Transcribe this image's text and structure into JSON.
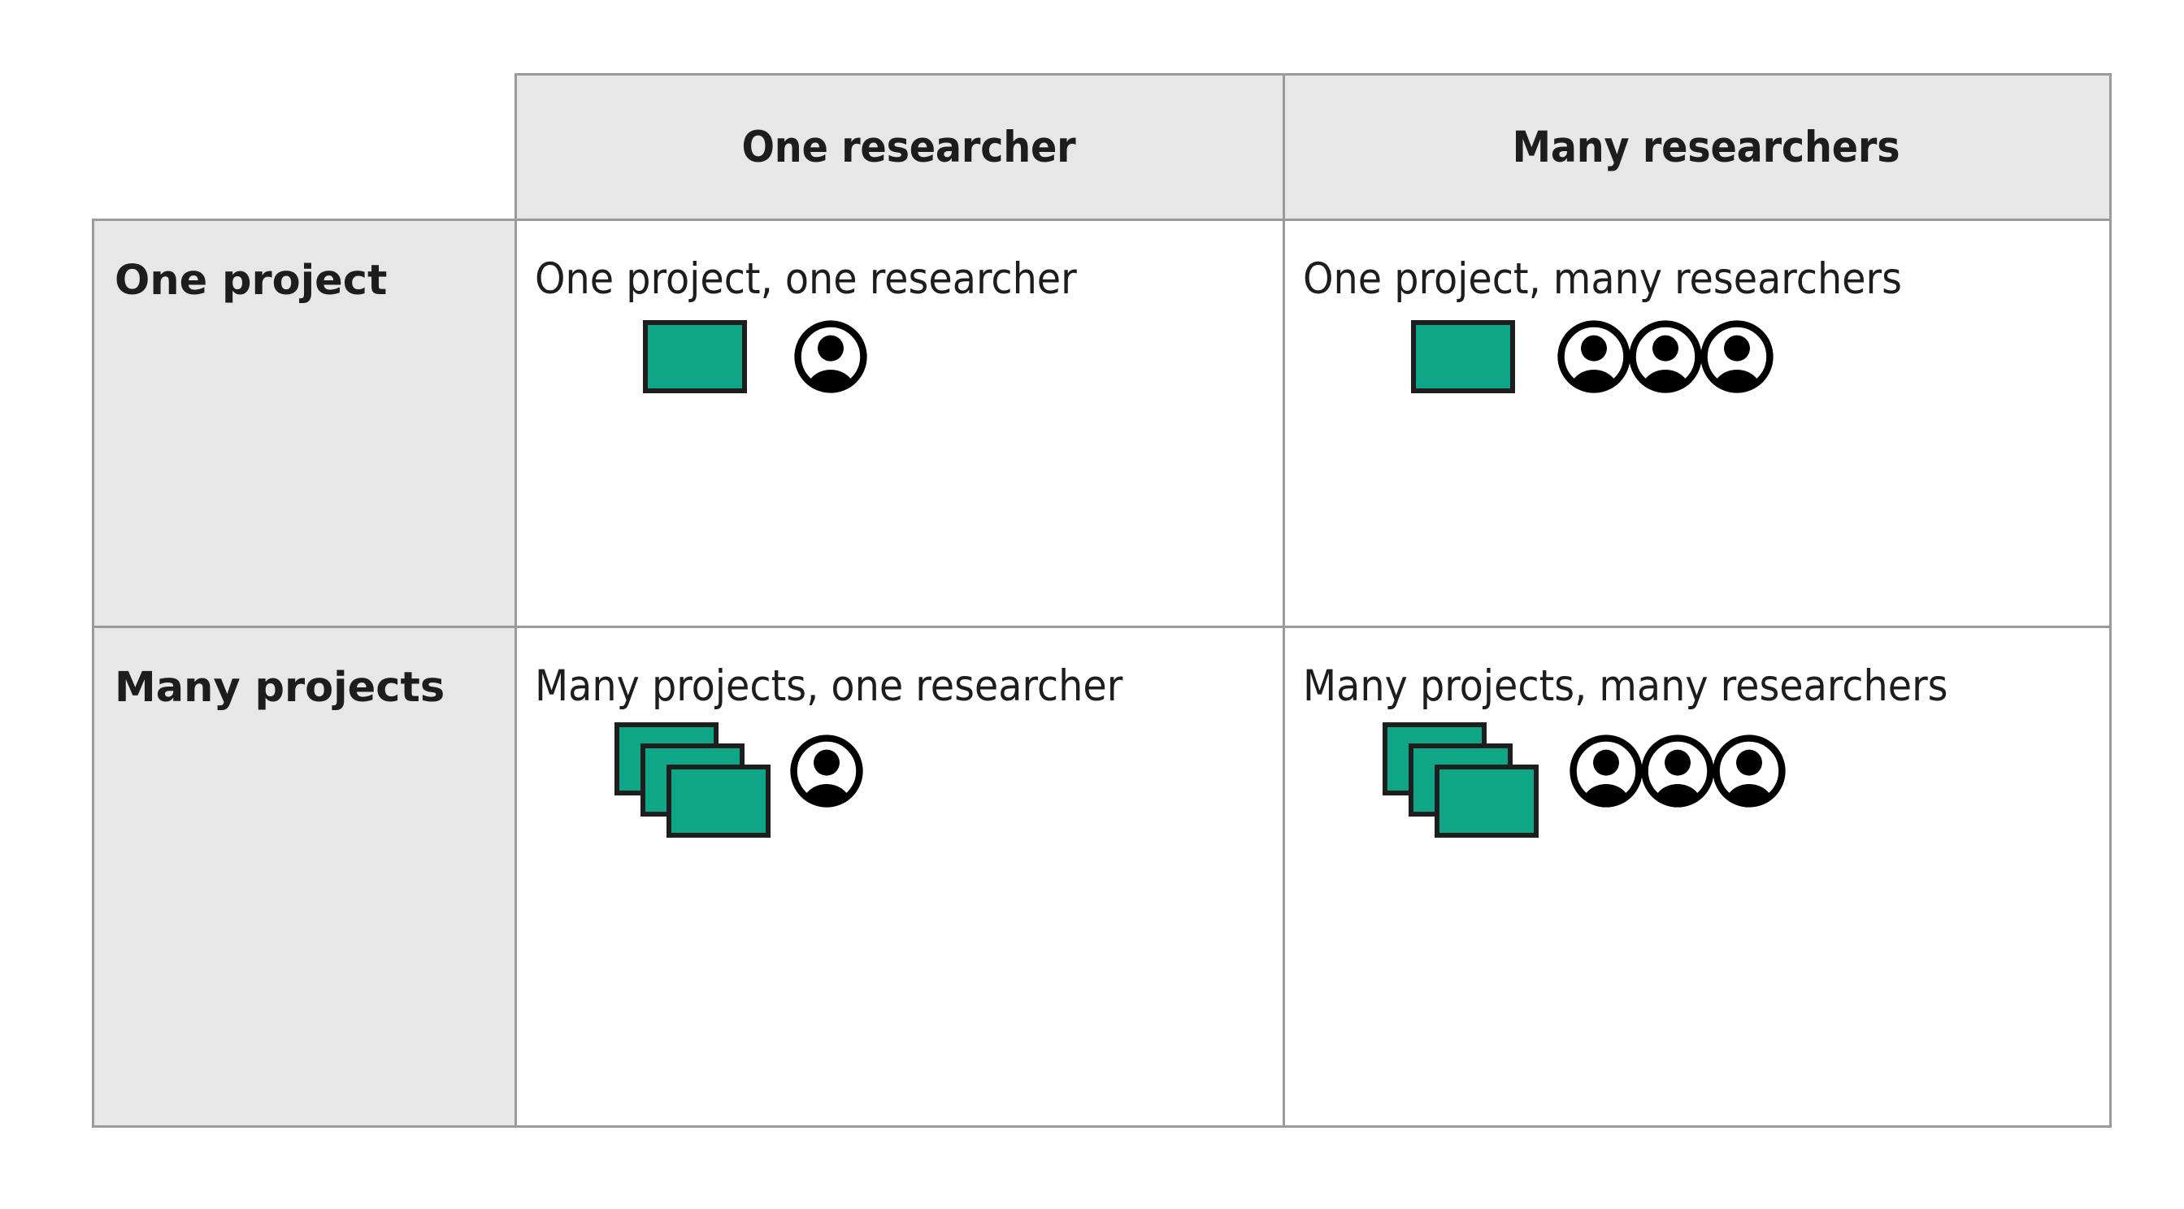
{
  "table": {
    "corner_label": "",
    "column_headers": [
      {
        "id": "one-researcher",
        "label": "One researcher"
      },
      {
        "id": "many-researchers",
        "label": "Many researchers"
      }
    ],
    "rows": [
      {
        "id": "one-project",
        "header": "One project",
        "cells": [
          {
            "id": "one-project-one-researcher",
            "caption": "One project, one researcher",
            "projects": 1,
            "researchers": 1,
            "project_icon": "project-rectangle-icon",
            "person_icon": "person-icon"
          },
          {
            "id": "one-project-many-researchers",
            "caption": "One project, many researchers",
            "projects": 1,
            "researchers": 3,
            "project_icon": "project-rectangle-icon",
            "person_icon": "person-icon"
          }
        ]
      },
      {
        "id": "many-projects",
        "header": "Many projects",
        "cells": [
          {
            "id": "many-projects-one-researcher",
            "caption": "Many projects, one researcher",
            "projects": 3,
            "researchers": 1,
            "project_icon": "project-stack-icon",
            "person_icon": "person-icon"
          },
          {
            "id": "many-projects-many-researchers",
            "caption": "Many projects, many researchers",
            "projects": 3,
            "researchers": 3,
            "project_icon": "project-stack-icon",
            "person_icon": "person-icon"
          }
        ]
      }
    ]
  },
  "colors": {
    "project_fill": "#0fa587",
    "project_stroke": "#1e1e1e",
    "header_background": "#e7e7e7",
    "grid_line": "#9b9b9b",
    "text": "#1d1d1d",
    "page_background": "#ffffff",
    "person_icon": "#000000"
  }
}
